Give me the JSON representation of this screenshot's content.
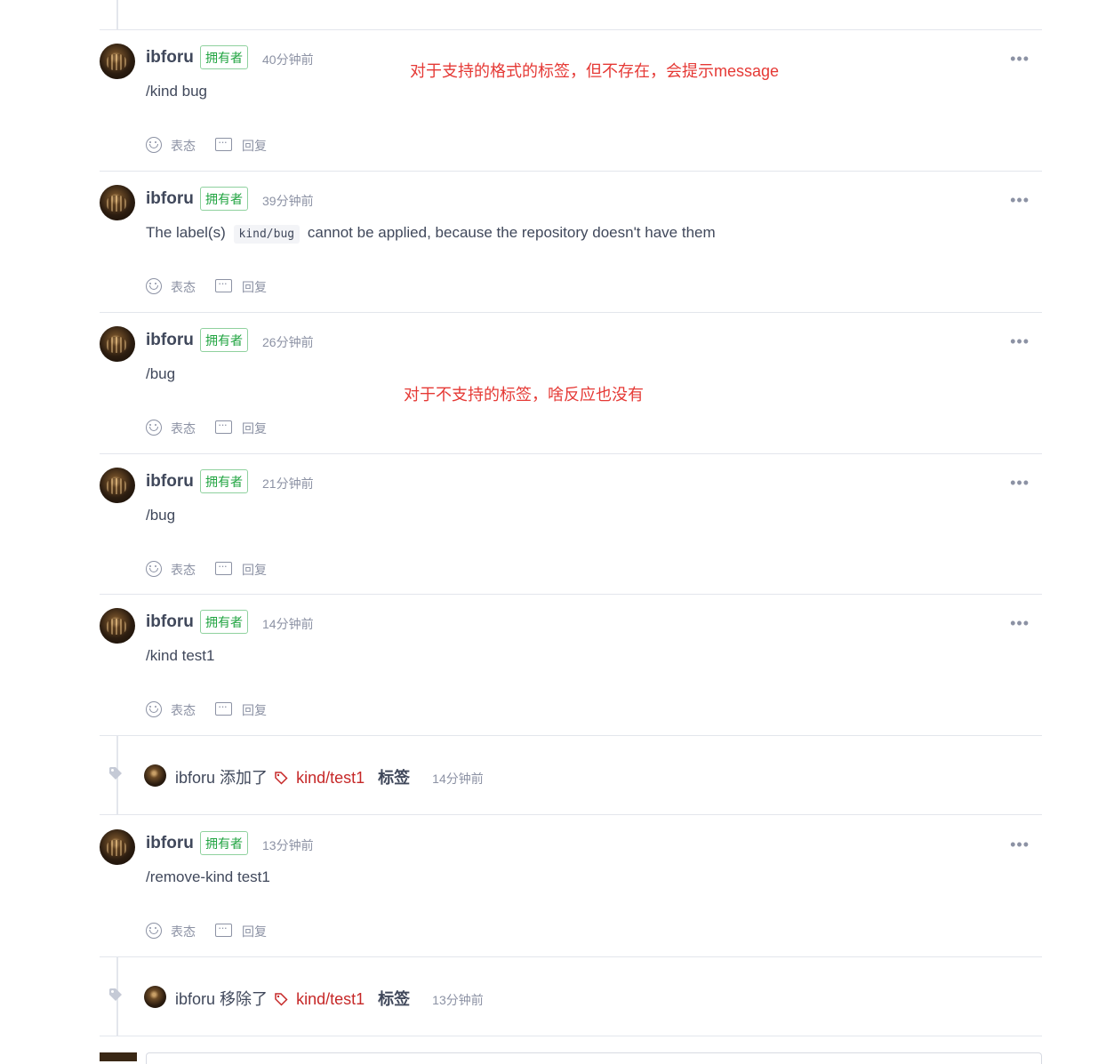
{
  "comments": [
    {
      "author": "ibforu",
      "badge": "拥有者",
      "time": "40分钟前",
      "text": "/kind bug",
      "react": "表态",
      "reply": "回复",
      "more": "•••"
    },
    {
      "author": "ibforu",
      "badge": "拥有者",
      "time": "39分钟前",
      "text_before": "The label(s)",
      "code": "kind/bug",
      "text_after": "cannot be applied, because the repository doesn't have them",
      "react": "表态",
      "reply": "回复",
      "more": "•••"
    },
    {
      "author": "ibforu",
      "badge": "拥有者",
      "time": "26分钟前",
      "text": "/bug",
      "react": "表态",
      "reply": "回复",
      "more": "•••"
    },
    {
      "author": "ibforu",
      "badge": "拥有者",
      "time": "21分钟前",
      "text": "/bug",
      "react": "表态",
      "reply": "回复",
      "more": "•••"
    },
    {
      "author": "ibforu",
      "badge": "拥有者",
      "time": "14分钟前",
      "text": "/kind test1",
      "react": "表态",
      "reply": "回复",
      "more": "•••"
    },
    {
      "author": "ibforu",
      "badge": "拥有者",
      "time": "13分钟前",
      "text": "/remove-kind test1",
      "react": "表态",
      "reply": "回复",
      "more": "•••"
    }
  ],
  "events": [
    {
      "actor": "ibforu",
      "action": "添加了",
      "label": "kind/test1",
      "suffix": "标签",
      "time": "14分钟前",
      "label_color": "#c62828"
    },
    {
      "actor": "ibforu",
      "action": "移除了",
      "label": "kind/test1",
      "suffix": "标签",
      "time": "13分钟前",
      "label_color": "#c62828"
    }
  ],
  "annotations": [
    "对于支持的格式的标签，但不存在，会提示message",
    "对于不支持的标签，啥反应也没有"
  ],
  "colors": {
    "badge": "#21a441",
    "annotation": "#e53935",
    "label": "#c62828",
    "muted": "#8c92a4"
  }
}
